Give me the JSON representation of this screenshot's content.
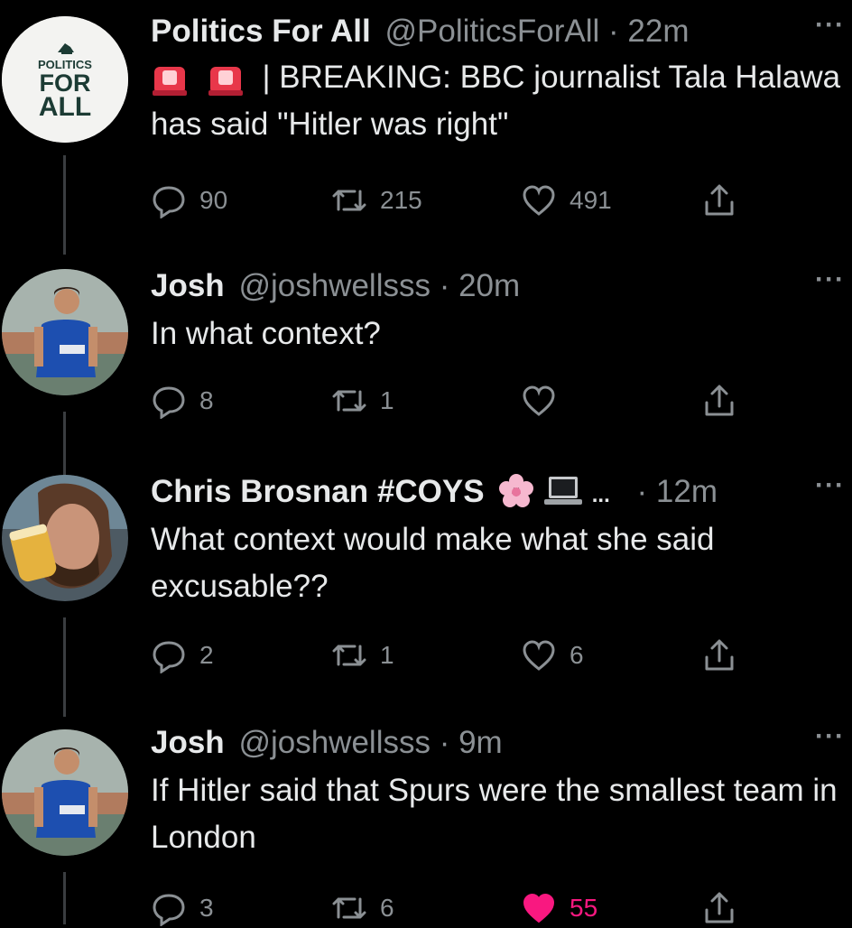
{
  "tweets": [
    {
      "avatar": "politics-for-all-logo",
      "avatar_text": [
        "POLITICS",
        "FOR",
        "ALL"
      ],
      "name": "Politics For All",
      "handle": "@PoliticsForAll",
      "separator": "·",
      "time": "22m",
      "more": "···",
      "text_lead_emojis": [
        "rotating-light-emoji",
        "rotating-light-emoji"
      ],
      "text": "| BREAKING: BBC journalist Tala Halawa has said \"Hitler was right\"",
      "replies": "90",
      "retweets": "215",
      "likes": "491",
      "liked": false
    },
    {
      "avatar": "footballer-photo",
      "name": "Josh",
      "handle": "@joshwellsss",
      "separator": "·",
      "time": "20m",
      "more": "···",
      "text": "In what context?",
      "replies": "8",
      "retweets": "1",
      "likes": "",
      "liked": false
    },
    {
      "avatar": "man-drinking-beer-photo",
      "name": "Chris Brosnan #COYS",
      "name_emojis": [
        "cherry-blossom-emoji",
        "laptop-emoji"
      ],
      "name_ellipsis": "...",
      "handle": "",
      "separator": "·",
      "time": "12m",
      "more": "···",
      "text": "What context would make what she said excusable??",
      "replies": "2",
      "retweets": "1",
      "likes": "6",
      "liked": false
    },
    {
      "avatar": "footballer-photo",
      "name": "Josh",
      "handle": "@joshwellsss",
      "separator": "·",
      "time": "9m",
      "more": "···",
      "text": "If Hitler said that Spurs were the smallest team in London",
      "replies": "3",
      "retweets": "6",
      "likes": "55",
      "liked": true
    }
  ],
  "colors": {
    "background": "#000000",
    "text": "#e7e9ea",
    "muted": "#8b9094",
    "like": "#f91880",
    "thread_line": "#3a3d40"
  }
}
